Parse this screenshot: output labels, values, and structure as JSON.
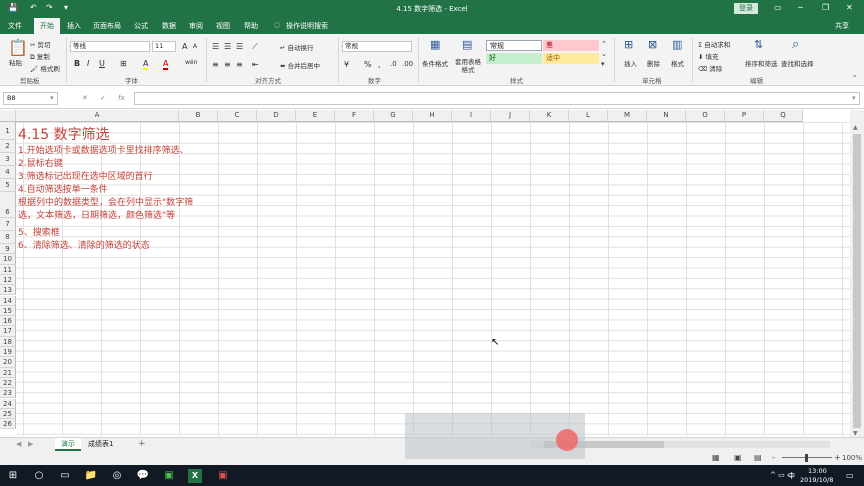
{
  "window": {
    "title": "4.15 数字筛选  -  Excel",
    "login": "登录",
    "share": "共享"
  },
  "qat": [
    "💾",
    "↶",
    "↷",
    "▾"
  ],
  "win_controls": [
    "▭",
    "─",
    "❐",
    "✕"
  ],
  "tabs": [
    "文件",
    "开始",
    "插入",
    "页面布局",
    "公式",
    "数据",
    "审阅",
    "视图",
    "帮助",
    "操作说明搜索"
  ],
  "ribbon": {
    "clipboard": {
      "paste": "粘贴",
      "cut": "剪切",
      "copy": "复制",
      "painter": "格式刷",
      "group": "剪贴板"
    },
    "font": {
      "name": "等线",
      "size": "11",
      "bold": "B",
      "italic": "I",
      "underline": "U",
      "grow": "A",
      "shrink": "A",
      "color": "A",
      "fill": "A",
      "wen": "wén",
      "group": "字体"
    },
    "align": {
      "wrap": "自动换行",
      "merge": "合并后居中",
      "group": "对齐方式"
    },
    "number": {
      "format": "常规",
      "percent": "%",
      "comma": ",",
      "group": "数字"
    },
    "styles": {
      "cond": "条件格式",
      "table": "套用表格格式",
      "normal": "常规",
      "bad": "差",
      "good": "好",
      "neutral": "适中",
      "group": "样式"
    },
    "cells": {
      "insert": "插入",
      "delete": "删除",
      "format": "格式",
      "group": "单元格"
    },
    "editing": {
      "sum": "自动求和",
      "fill": "填充",
      "clear": "清除",
      "sort": "排序和筛选",
      "find": "查找和选择",
      "group": "编辑"
    },
    "colors": {
      "bad_bg": "#ffc7ce",
      "good_bg": "#c6efce",
      "neutral_bg": "#ffeb9c",
      "good_fg": "#006100",
      "bad_fg": "#9c0006",
      "neutral_fg": "#9c5700",
      "accent": "#217346"
    }
  },
  "formula": {
    "namebox": "B8",
    "cancel": "✕",
    "enter": "✓",
    "fx": "fx",
    "content": ""
  },
  "columns": [
    "A",
    "B",
    "C",
    "D",
    "E",
    "F",
    "G",
    "H",
    "I",
    "J",
    "K",
    "L",
    "M",
    "N",
    "O",
    "P",
    "Q"
  ],
  "rows": [
    "1",
    "2",
    "3",
    "4",
    "5",
    "6",
    "7",
    "8",
    "9",
    "10",
    "11",
    "12",
    "13",
    "14",
    "15",
    "16",
    "17",
    "18",
    "19",
    "20",
    "21",
    "22",
    "23",
    "24",
    "25",
    "26"
  ],
  "cells": {
    "A1": "4.15 数字筛选",
    "A2": "1.开始选项卡或数据选项卡里找排序筛选、",
    "A3": "2.鼠标右键",
    "A4": "3.筛选标记出现在选中区域的首行",
    "A5": "4.自动筛选按单一条件",
    "A6a": "根据列中的数据类型，会在列中显示\"数字筛",
    "A6b": "选，文本筛选，日期筛选，颜色筛选\"等",
    "A7": "5、搜索框",
    "A8": "6、清除筛选、清除的筛选的状态"
  },
  "sheets": [
    "演示",
    "成绩表1"
  ],
  "add_sheet": "+",
  "status": {
    "zoom": "100%",
    "zoom_minus": "-",
    "zoom_plus": "+"
  },
  "taskbar": {
    "time": "13:00",
    "date": "2019/10/8",
    "ime": "中",
    "icons": [
      "⊞",
      "○",
      "▭",
      "📁",
      "◎",
      "💬",
      "▣",
      "X",
      "▣"
    ]
  }
}
